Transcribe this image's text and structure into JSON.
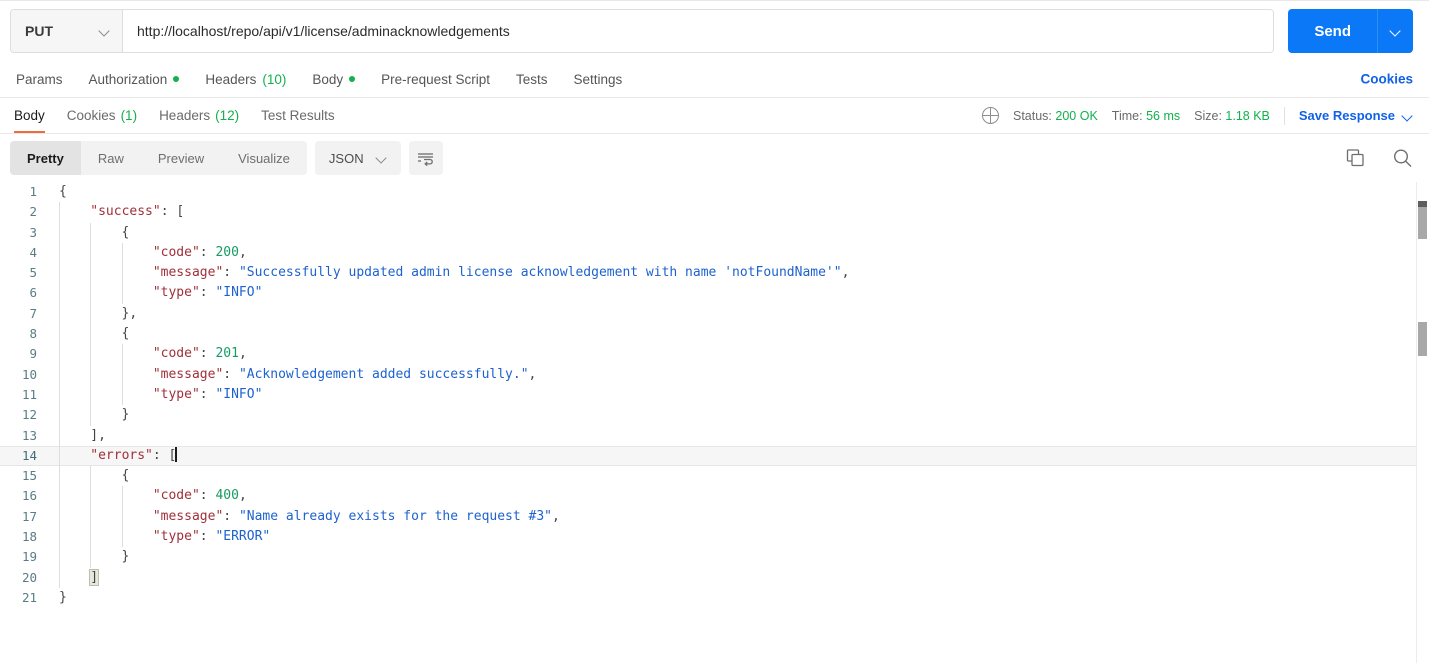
{
  "request": {
    "method": "PUT",
    "url": "http://localhost/repo/api/v1/license/adminacknowledgements",
    "send_label": "Send"
  },
  "request_tabs": [
    {
      "label": "Params",
      "dot": false,
      "count": ""
    },
    {
      "label": "Authorization",
      "dot": true,
      "count": ""
    },
    {
      "label": "Headers",
      "dot": false,
      "count": "(10)"
    },
    {
      "label": "Body",
      "dot": true,
      "count": ""
    },
    {
      "label": "Pre-request Script",
      "dot": false,
      "count": ""
    },
    {
      "label": "Tests",
      "dot": false,
      "count": ""
    },
    {
      "label": "Settings",
      "dot": false,
      "count": ""
    }
  ],
  "cookies_link": "Cookies",
  "response_tabs": [
    {
      "label": "Body",
      "count": "",
      "active": true
    },
    {
      "label": "Cookies",
      "count": "(1)",
      "active": false
    },
    {
      "label": "Headers",
      "count": "(12)",
      "active": false
    },
    {
      "label": "Test Results",
      "count": "",
      "active": false
    }
  ],
  "response_meta": {
    "status_label": "Status:",
    "status_value": "200 OK",
    "time_label": "Time:",
    "time_value": "56 ms",
    "size_label": "Size:",
    "size_value": "1.18 KB",
    "save_response": "Save Response"
  },
  "format_bar": {
    "views": [
      {
        "label": "Pretty",
        "active": true
      },
      {
        "label": "Raw",
        "active": false
      },
      {
        "label": "Preview",
        "active": false
      },
      {
        "label": "Visualize",
        "active": false
      }
    ],
    "language": "JSON"
  },
  "colors": {
    "accent_blue": "#0b79f7",
    "link_blue": "#1162e8",
    "green": "#11b14c",
    "underline_orange": "#f26b3a",
    "json_key": "#a0303a",
    "json_string": "#1d62cf",
    "json_number": "#169b62"
  },
  "body": {
    "language": "JSON",
    "lines": [
      {
        "no": 1,
        "indent": 0,
        "tokens": [
          {
            "t": "p",
            "v": "{"
          }
        ]
      },
      {
        "no": 2,
        "indent": 1,
        "tokens": [
          {
            "t": "k",
            "v": "\"success\""
          },
          {
            "t": "p",
            "v": ": ["
          }
        ]
      },
      {
        "no": 3,
        "indent": 2,
        "tokens": [
          {
            "t": "p",
            "v": "{"
          }
        ]
      },
      {
        "no": 4,
        "indent": 3,
        "tokens": [
          {
            "t": "k",
            "v": "\"code\""
          },
          {
            "t": "p",
            "v": ": "
          },
          {
            "t": "n",
            "v": "200"
          },
          {
            "t": "p",
            "v": ","
          }
        ]
      },
      {
        "no": 5,
        "indent": 3,
        "tokens": [
          {
            "t": "k",
            "v": "\"message\""
          },
          {
            "t": "p",
            "v": ": "
          },
          {
            "t": "s",
            "v": "\"Successfully updated admin license acknowledgement with name 'notFoundName'\""
          },
          {
            "t": "p",
            "v": ","
          }
        ]
      },
      {
        "no": 6,
        "indent": 3,
        "tokens": [
          {
            "t": "k",
            "v": "\"type\""
          },
          {
            "t": "p",
            "v": ": "
          },
          {
            "t": "s",
            "v": "\"INFO\""
          }
        ]
      },
      {
        "no": 7,
        "indent": 2,
        "tokens": [
          {
            "t": "p",
            "v": "},"
          }
        ]
      },
      {
        "no": 8,
        "indent": 2,
        "tokens": [
          {
            "t": "p",
            "v": "{"
          }
        ]
      },
      {
        "no": 9,
        "indent": 3,
        "tokens": [
          {
            "t": "k",
            "v": "\"code\""
          },
          {
            "t": "p",
            "v": ": "
          },
          {
            "t": "n",
            "v": "201"
          },
          {
            "t": "p",
            "v": ","
          }
        ]
      },
      {
        "no": 10,
        "indent": 3,
        "tokens": [
          {
            "t": "k",
            "v": "\"message\""
          },
          {
            "t": "p",
            "v": ": "
          },
          {
            "t": "s",
            "v": "\"Acknowledgement added successfully.\""
          },
          {
            "t": "p",
            "v": ","
          }
        ]
      },
      {
        "no": 11,
        "indent": 3,
        "tokens": [
          {
            "t": "k",
            "v": "\"type\""
          },
          {
            "t": "p",
            "v": ": "
          },
          {
            "t": "s",
            "v": "\"INFO\""
          }
        ]
      },
      {
        "no": 12,
        "indent": 2,
        "tokens": [
          {
            "t": "p",
            "v": "}"
          }
        ]
      },
      {
        "no": 13,
        "indent": 1,
        "tokens": [
          {
            "t": "p",
            "v": "],"
          }
        ]
      },
      {
        "no": 14,
        "indent": 1,
        "highlight": true,
        "tokens": [
          {
            "t": "k",
            "v": "\"errors\""
          },
          {
            "t": "p",
            "v": ": "
          },
          {
            "t": "p",
            "v": "["
          },
          {
            "t": "cursor",
            "v": ""
          }
        ]
      },
      {
        "no": 15,
        "indent": 2,
        "tokens": [
          {
            "t": "p",
            "v": "{"
          }
        ]
      },
      {
        "no": 16,
        "indent": 3,
        "tokens": [
          {
            "t": "k",
            "v": "\"code\""
          },
          {
            "t": "p",
            "v": ": "
          },
          {
            "t": "n",
            "v": "400"
          },
          {
            "t": "p",
            "v": ","
          }
        ]
      },
      {
        "no": 17,
        "indent": 3,
        "tokens": [
          {
            "t": "k",
            "v": "\"message\""
          },
          {
            "t": "p",
            "v": ": "
          },
          {
            "t": "s",
            "v": "\"Name already exists for the request #3\""
          },
          {
            "t": "p",
            "v": ","
          }
        ]
      },
      {
        "no": 18,
        "indent": 3,
        "tokens": [
          {
            "t": "k",
            "v": "\"type\""
          },
          {
            "t": "p",
            "v": ": "
          },
          {
            "t": "s",
            "v": "\"ERROR\""
          }
        ]
      },
      {
        "no": 19,
        "indent": 2,
        "tokens": [
          {
            "t": "p",
            "v": "}"
          }
        ]
      },
      {
        "no": 20,
        "indent": 1,
        "tokens": [
          {
            "t": "brmatch",
            "v": "]"
          }
        ]
      },
      {
        "no": 21,
        "indent": 0,
        "tokens": [
          {
            "t": "p",
            "v": "}"
          }
        ]
      }
    ]
  }
}
